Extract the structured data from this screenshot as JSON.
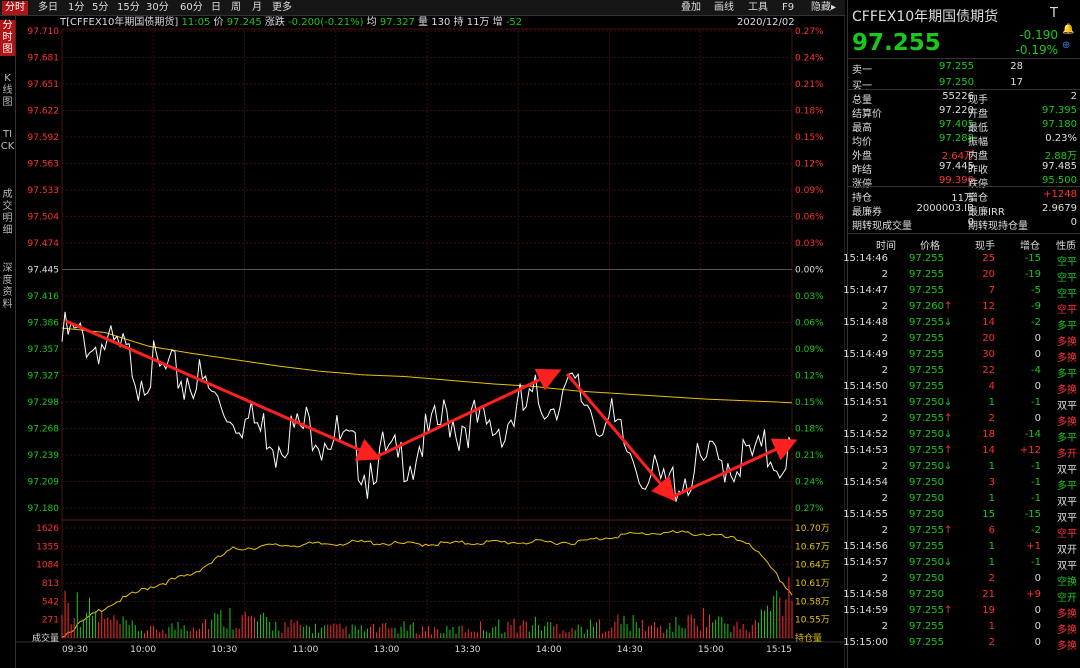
{
  "period_tabs": [
    "分时",
    "多日",
    "1分",
    "5分",
    "15分",
    "30分",
    "60分",
    "日",
    "周",
    "月",
    "更多"
  ],
  "right_tabs": [
    "叠加",
    "画线",
    "工具",
    "F9",
    "隐藏▸"
  ],
  "left_tabs": [
    "分时图",
    "K线图",
    "TICK",
    "成交明细",
    "深度资料"
  ],
  "info": {
    "symbol": "T[CFFEX10年期国债期货]",
    "time": "11:05",
    "price_label": "价",
    "price": "97.245",
    "change_label": "涨跌",
    "change": "-0.200(-0.21%)",
    "avg_label": "均",
    "avg": "97.327",
    "vol_label": "量",
    "vol": "130",
    "oi_label": "持",
    "oi": "11万",
    "inc_label": "增",
    "inc": "-52",
    "date": "2020/12/02"
  },
  "axes": {
    "price_ticks": [
      "97.710",
      "97.681",
      "97.651",
      "97.622",
      "97.592",
      "97.563",
      "97.533",
      "97.504",
      "97.474",
      "97.445",
      "97.416",
      "97.386",
      "97.357",
      "97.327",
      "97.298",
      "97.268",
      "97.239",
      "97.209",
      "97.180"
    ],
    "pct_ticks": [
      "0.27%",
      "0.24%",
      "0.21%",
      "0.18%",
      "0.15%",
      "0.12%",
      "0.09%",
      "0.06%",
      "0.03%",
      "0.00%",
      "0.03%",
      "0.06%",
      "0.09%",
      "0.12%",
      "0.15%",
      "0.18%",
      "0.21%",
      "0.24%",
      "0.27%"
    ],
    "vol_ticks": [
      "1626",
      "1355",
      "1084",
      "813",
      "542",
      "271",
      "成交量"
    ],
    "oi_ticks": [
      "10.70万",
      "10.67万",
      "10.64万",
      "10.61万",
      "10.58万",
      "10.55万",
      "持仓量"
    ],
    "time_ticks": [
      "09:30",
      "10:00",
      "10:30",
      "11:00",
      "13:00",
      "13:30",
      "14:00",
      "14:30",
      "15:00",
      "15:15"
    ]
  },
  "chart_data": {
    "type": "line",
    "preclose": 97.445,
    "ylim": [
      97.18,
      97.71
    ],
    "x": [
      "09:30",
      "09:45",
      "10:00",
      "10:15",
      "10:30",
      "10:45",
      "11:00",
      "11:15",
      "13:00",
      "13:15",
      "13:30",
      "13:45",
      "14:00",
      "14:15",
      "14:30",
      "14:45",
      "15:00",
      "15:15"
    ],
    "series": [
      {
        "values": [
          97.387,
          97.375,
          97.345,
          97.34,
          97.3,
          97.275,
          97.285,
          97.245,
          97.25,
          97.295,
          97.28,
          97.31,
          97.325,
          97.27,
          97.215,
          97.245,
          97.25,
          97.255
        ]
      },
      {
        "values": [
          97.38,
          97.375,
          97.36,
          97.352,
          97.345,
          97.338,
          97.332,
          97.328,
          97.326,
          97.322,
          97.318,
          97.315,
          97.31,
          97.307,
          97.304,
          97.301,
          97.299,
          97.297
        ]
      }
    ],
    "open_interest": {
      "ylim": [
        105450,
        107150
      ],
      "values": [
        105500,
        105950,
        106250,
        106450,
        106850,
        106900,
        106920,
        106950,
        106920,
        106930,
        106950,
        106950,
        106950,
        107060,
        107100,
        107080,
        106950,
        106150
      ]
    },
    "volume": {
      "ylim": [
        0,
        1900
      ],
      "values": [
        820,
        360,
        140,
        280,
        450,
        260,
        200,
        170,
        210,
        150,
        240,
        280,
        190,
        330,
        200,
        420,
        160,
        1100
      ]
    }
  },
  "panel": {
    "title": "CFFEX10年期国债期货",
    "t_label": "T",
    "price": "97.255",
    "change": "-0.190",
    "change_pct": "-0.19%",
    "sell_label": "卖一",
    "sell_price": "97.255",
    "sell_vol": "28",
    "buy_label": "买一",
    "buy_price": "97.250",
    "buy_vol": "17",
    "stats": [
      [
        "总量",
        "55226",
        "w",
        "现手",
        "2",
        "w"
      ],
      [
        "结算价",
        "97.220",
        "w",
        "开盘",
        "97.395",
        "g"
      ],
      [
        "最高",
        "97.405",
        "g",
        "最低",
        "97.180",
        "g"
      ],
      [
        "均价",
        "97.288",
        "g",
        "振幅",
        "0.23%",
        "w"
      ],
      [
        "外盘",
        "2.64万",
        "r",
        "内盘",
        "2.88万",
        "g"
      ],
      [
        "昨结",
        "97.445",
        "w",
        "昨收",
        "97.485",
        "w"
      ],
      [
        "涨停",
        "99.390",
        "r",
        "跌停",
        "95.500",
        "g"
      ]
    ],
    "oi_rows": [
      [
        "持仓",
        "11万",
        "w",
        "增仓",
        "+1248",
        "r"
      ],
      [
        "最廉券",
        "2000003.IB",
        "w",
        "最廉IRR",
        "2.9679",
        "w"
      ],
      [
        "期转现成交量",
        "0",
        "w",
        "期转现持仓量",
        "0",
        "w"
      ]
    ],
    "tick_headers": [
      "时间",
      "价格",
      "现手",
      "增仓",
      "性质"
    ],
    "ticks": [
      [
        "15:14:46",
        "97.255",
        "",
        "25",
        "-15",
        "空平",
        "g"
      ],
      [
        "2",
        "97.255",
        "",
        "20",
        "-19",
        "空平",
        "g"
      ],
      [
        "15:14:47",
        "97.255",
        "",
        "7",
        "-5",
        "空平",
        "g"
      ],
      [
        "2",
        "97.260",
        "↑",
        "12",
        "-9",
        "空平",
        "r"
      ],
      [
        "15:14:48",
        "97.255",
        "↓",
        "14",
        "-2",
        "多平",
        "g"
      ],
      [
        "2",
        "97.255",
        "",
        "20",
        "0",
        "多换",
        "r"
      ],
      [
        "15:14:49",
        "97.255",
        "",
        "30",
        "0",
        "多换",
        "r"
      ],
      [
        "2",
        "97.255",
        "",
        "22",
        "-4",
        "多平",
        "g"
      ],
      [
        "15:14:50",
        "97.255",
        "",
        "4",
        "0",
        "多换",
        "r"
      ],
      [
        "15:14:51",
        "97.250",
        "↓",
        "1",
        "-1",
        "双平",
        "w"
      ],
      [
        "2",
        "97.255",
        "↑",
        "2",
        "0",
        "多换",
        "r"
      ],
      [
        "15:14:52",
        "97.250",
        "↓",
        "18",
        "-14",
        "多平",
        "g"
      ],
      [
        "15:14:53",
        "97.255",
        "↑",
        "14",
        "+12",
        "多开",
        "r"
      ],
      [
        "2",
        "97.250",
        "↓",
        "1",
        "-1",
        "双平",
        "w"
      ],
      [
        "15:14:54",
        "97.250",
        "",
        "3",
        "-1",
        "多平",
        "g"
      ],
      [
        "2",
        "97.250",
        "",
        "1",
        "-1",
        "双平",
        "w"
      ],
      [
        "15:14:55",
        "97.250",
        "",
        "15",
        "-15",
        "双平",
        "w"
      ],
      [
        "2",
        "97.255",
        "↑",
        "6",
        "-2",
        "空平",
        "r"
      ],
      [
        "15:14:56",
        "97.255",
        "",
        "1",
        "+1",
        "双开",
        "w"
      ],
      [
        "15:14:57",
        "97.250",
        "↓",
        "1",
        "-1",
        "双平",
        "w"
      ],
      [
        "2",
        "97.250",
        "",
        "2",
        "0",
        "空换",
        "g"
      ],
      [
        "15:14:58",
        "97.250",
        "",
        "21",
        "+9",
        "空开",
        "g"
      ],
      [
        "15:14:59",
        "97.255",
        "↑",
        "19",
        "0",
        "多换",
        "r"
      ],
      [
        "2",
        "97.255",
        "",
        "1",
        "0",
        "多换",
        "r"
      ],
      [
        "15:15:00",
        "97.255",
        "",
        "2",
        "0",
        "多换",
        "r"
      ]
    ]
  },
  "colors": {
    "up": "#ff3030",
    "down": "#19c919",
    "avg": "#e6c200",
    "price_line": "#ffffff",
    "arrow": "#ff2020",
    "accent": "#b01515"
  }
}
